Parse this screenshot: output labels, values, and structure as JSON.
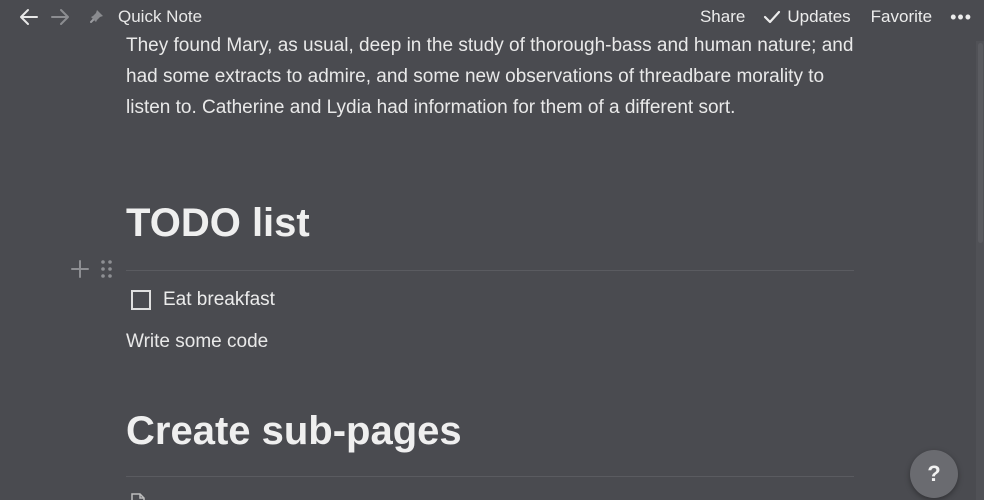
{
  "topbar": {
    "page_name": "Quick Note",
    "share_label": "Share",
    "updates_label": "Updates",
    "favorite_label": "Favorite",
    "more_label": "•••"
  },
  "document": {
    "paragraph": "They found Mary, as usual, deep in the study of thorough-bass and human nature; and had some extracts to admire, and some new observations of threadbare morality to listen to. Catherine and Lydia had information for them of a different sort.",
    "heading_todo": "TODO list",
    "todo_items": [
      {
        "label": "Eat breakfast",
        "checked": false
      }
    ],
    "plain_line": "Write some code",
    "heading_subpages": "Create sub-pages"
  },
  "help": {
    "label": "?"
  },
  "colors": {
    "background": "#4a4b50",
    "text": "#e9e9e9",
    "divider": "#5a5b60",
    "help_button": "#6a6b70"
  }
}
